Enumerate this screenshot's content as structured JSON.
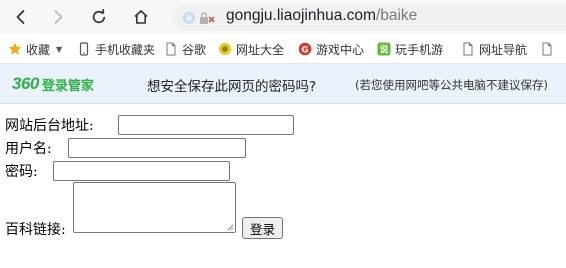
{
  "browser": {
    "url_host": "gongju.liaojinhua.com",
    "url_path": "/baike",
    "nav_icons": [
      "back-icon",
      "forward-icon",
      "reload-icon",
      "home-icon"
    ]
  },
  "bookmarks": [
    {
      "label": "收藏",
      "icon": "star-icon",
      "has_dropdown": true
    },
    {
      "label": "手机收藏夹",
      "icon": "phone-icon"
    },
    {
      "label": "谷歌",
      "icon": "page-icon"
    },
    {
      "label": "网址大全",
      "icon": "sunflower-icon"
    },
    {
      "label": "游戏中心",
      "icon": "game-icon"
    },
    {
      "label": "玩手机游",
      "icon": "game-app-icon"
    },
    {
      "label": "网址导航",
      "icon": "page-icon"
    },
    {
      "label": "",
      "icon": "page-icon"
    }
  ],
  "password_bar": {
    "logo_number": "360",
    "logo_text": "登录管家",
    "question": "想安全保存此网页的密码吗?",
    "note": "(若您使用网吧等公共电脑不建议保存)"
  },
  "form": {
    "site_label": "网站后台地址:",
    "site_value": "",
    "username_label": "用户名:",
    "username_value": "",
    "password_label": "密码:",
    "password_value": "",
    "link_label": "百科链接:",
    "link_value": "",
    "submit_label": "登录"
  }
}
